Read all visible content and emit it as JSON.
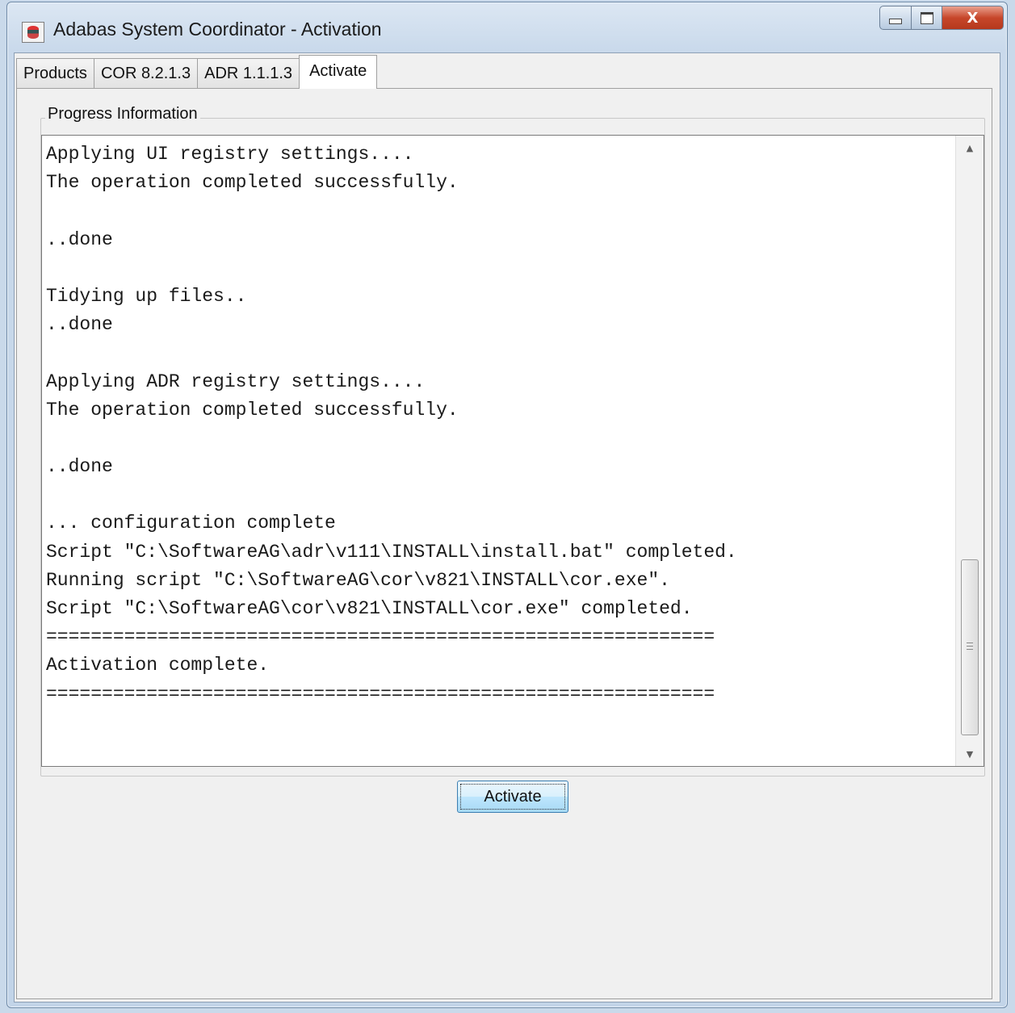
{
  "window": {
    "title": "Adabas System Coordinator - Activation",
    "minimize_glyph": "",
    "maximize_glyph": "",
    "close_glyph": "X"
  },
  "tabs": [
    {
      "label": "Products",
      "active": false
    },
    {
      "label": "COR 8.2.1.3",
      "active": false
    },
    {
      "label": "ADR 1.1.1.3",
      "active": false
    },
    {
      "label": "Activate",
      "active": true
    }
  ],
  "progress": {
    "group_label": "Progress Information",
    "lines": [
      "Applying UI registry settings....",
      "The operation completed successfully.",
      "",
      "..done",
      "",
      "Tidying up files..",
      "..done",
      "",
      "Applying ADR registry settings....",
      "The operation completed successfully.",
      "",
      "..done",
      "",
      "... configuration complete",
      "Script \"C:\\SoftwareAG\\adr\\v111\\INSTALL\\install.bat\" completed.",
      "Running script \"C:\\SoftwareAG\\cor\\v821\\INSTALL\\cor.exe\".",
      "Script \"C:\\SoftwareAG\\cor\\v821\\INSTALL\\cor.exe\" completed.",
      "============================================================",
      "Activation complete.",
      "============================================================"
    ]
  },
  "actions": {
    "activate_label": "Activate"
  },
  "icons": {
    "app": "database-icon",
    "scroll_up": "arrow-up-icon",
    "scroll_down": "arrow-down-icon",
    "thumb_grip": "grip-icon"
  },
  "colors": {
    "close_button": "#c7472b",
    "button_border": "#3c7fb1"
  }
}
